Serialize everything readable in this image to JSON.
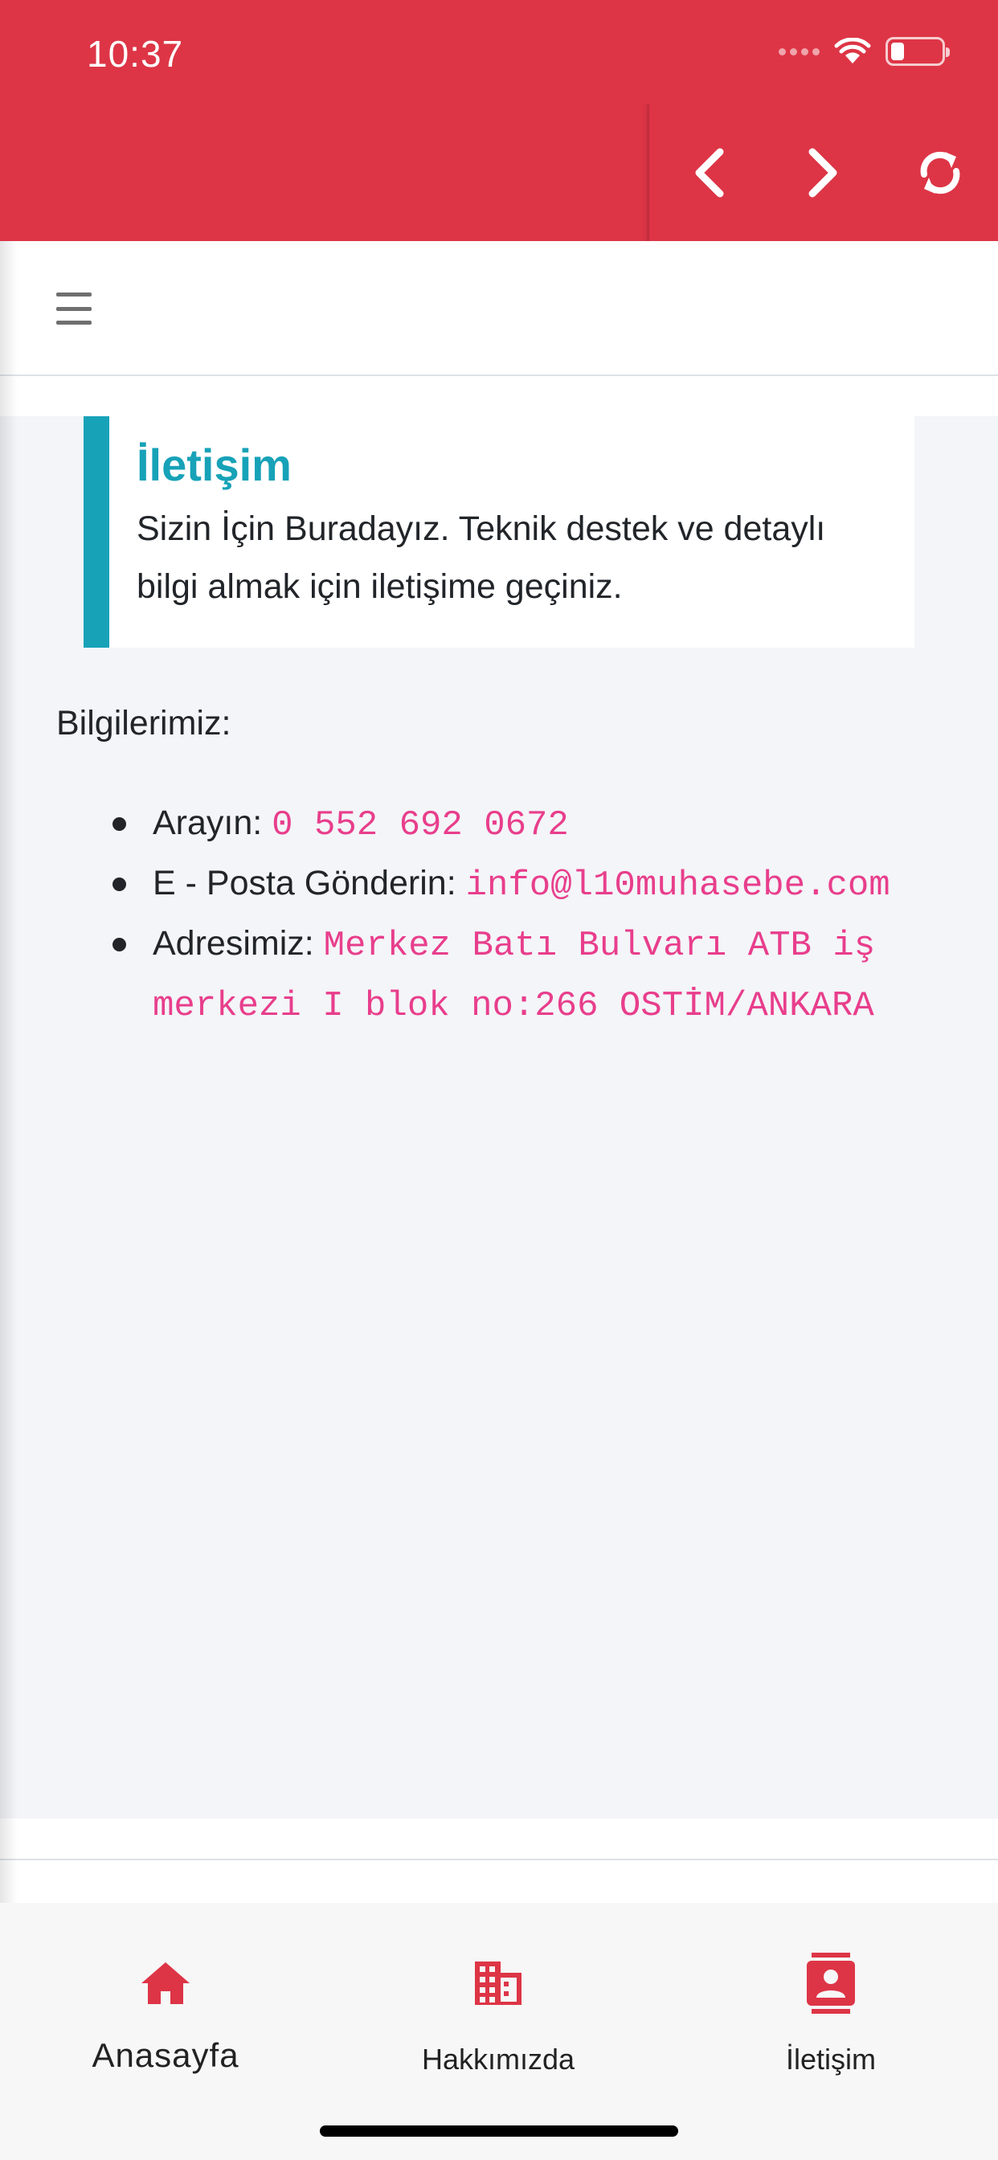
{
  "status_bar": {
    "time": "10:37"
  },
  "toolbar": {
    "back_icon": "chevron-left-icon",
    "forward_icon": "chevron-right-icon",
    "reload_icon": "sync-icon"
  },
  "colors": {
    "brand": "#dd3546",
    "accent": "#17a2b8",
    "code": "#e83e8c"
  },
  "callout": {
    "title": "İletişim",
    "text": "Sizin İçin Buradayız. Teknik destek ve detaylı bilgi almak için iletişime geçiniz."
  },
  "info": {
    "label": "Bilgilerimiz:",
    "items": [
      {
        "label": "Arayın: ",
        "value": "0 552 692 0672"
      },
      {
        "label": "E - Posta Gönderin: ",
        "value": "info@l10muhasebe.com"
      },
      {
        "label": "Adresimiz: ",
        "value": "Merkez Batı Bulvarı ATB iş merkezi I blok no:266 OSTİM/ANKARA"
      }
    ]
  },
  "tabs": [
    {
      "label": "Anasayfa",
      "icon": "home-icon"
    },
    {
      "label": "Hakkımızda",
      "icon": "building-icon"
    },
    {
      "label": "İletişim",
      "icon": "contact-card-icon"
    }
  ]
}
